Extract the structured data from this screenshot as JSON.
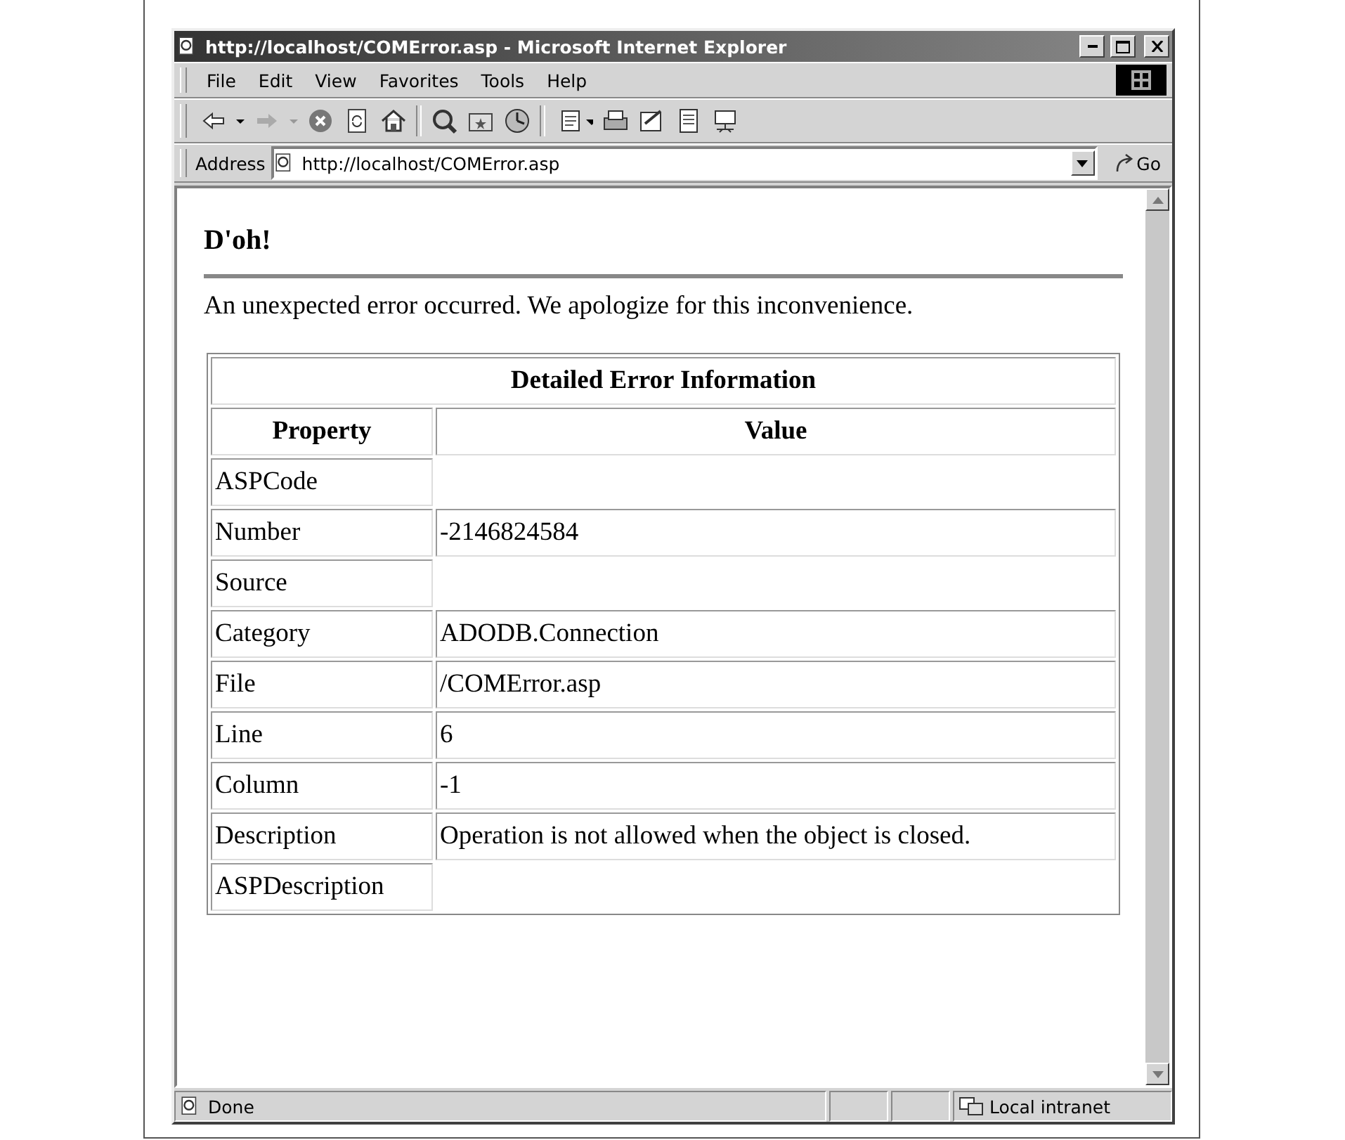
{
  "window": {
    "title": "http://localhost/COMError.asp - Microsoft Internet Explorer"
  },
  "menu": [
    "File",
    "Edit",
    "View",
    "Favorites",
    "Tools",
    "Help"
  ],
  "address": {
    "label": "Address",
    "value": "http://localhost/COMError.asp",
    "go": "Go"
  },
  "page": {
    "heading": "D'oh!",
    "message": "An unexpected error occurred. We apologize for this inconvenience.",
    "table": {
      "caption": "Detailed Error Information",
      "columns": [
        "Property",
        "Value"
      ],
      "rows": [
        {
          "property": "ASPCode"
        },
        {
          "property": "Number",
          "value": "-2146824584"
        },
        {
          "property": "Source"
        },
        {
          "property": "Category",
          "value": "ADODB.Connection"
        },
        {
          "property": "File",
          "value": "/COMError.asp"
        },
        {
          "property": "Line",
          "value": "6"
        },
        {
          "property": "Column",
          "value": "-1"
        },
        {
          "property": "Description",
          "value": "Operation is not allowed when the object is closed."
        },
        {
          "property": "ASPDescription"
        }
      ]
    }
  },
  "status_bar": {
    "text": "Done",
    "zone": "Local intranet"
  }
}
